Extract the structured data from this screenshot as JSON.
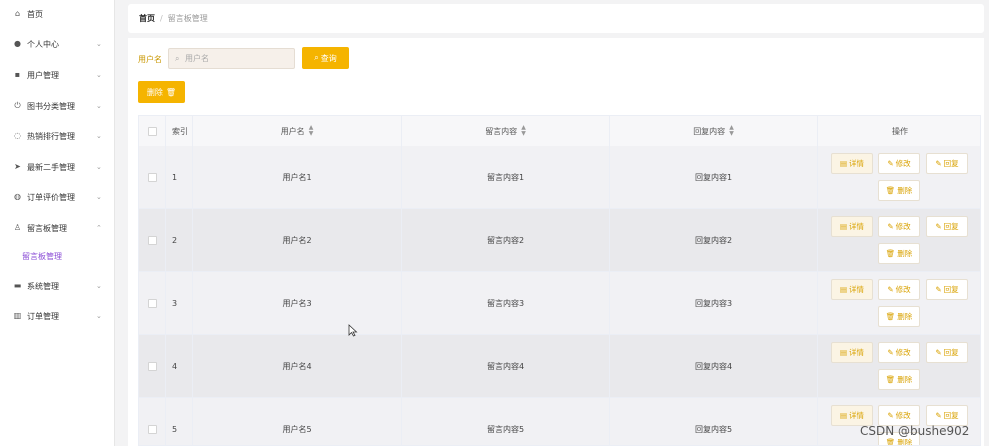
{
  "sidebar": {
    "items": [
      {
        "label": "首页",
        "icon": "home-icon",
        "glyph": "⌂",
        "expandable": false
      },
      {
        "label": "个人中心",
        "icon": "user-icon",
        "glyph": "●",
        "expandable": true
      },
      {
        "label": "用户管理",
        "icon": "users-icon",
        "glyph": "▪",
        "expandable": true
      },
      {
        "label": "图书分类管理",
        "icon": "power-icon",
        "glyph": "⏻",
        "expandable": true
      },
      {
        "label": "热销排行管理",
        "icon": "bulb-icon",
        "glyph": "◌",
        "expandable": true
      },
      {
        "label": "最新二手管理",
        "icon": "send-icon",
        "glyph": "➤",
        "expandable": true
      },
      {
        "label": "订单评价管理",
        "icon": "globe-icon",
        "glyph": "◍",
        "expandable": true
      },
      {
        "label": "留言板管理",
        "icon": "person-icon",
        "glyph": "♙",
        "expandable": true,
        "expanded": true
      },
      {
        "label": "系统管理",
        "icon": "server-icon",
        "glyph": "▬",
        "expandable": true
      },
      {
        "label": "订单管理",
        "icon": "chart-icon",
        "glyph": "▥",
        "expandable": true
      }
    ],
    "sub_item": "留言板管理",
    "chevron_down": "⌄",
    "chevron_up": "⌃"
  },
  "breadcrumb": {
    "home": "首页",
    "separator": "/",
    "current": "留言板管理"
  },
  "search": {
    "label": "用户名",
    "placeholder": "用户名",
    "value": "",
    "button": "查询"
  },
  "toolbar": {
    "delete_label": "删除"
  },
  "table": {
    "headers": {
      "index": "索引",
      "username": "用户名",
      "content": "留言内容",
      "reply": "回复内容",
      "actions": "操作"
    },
    "rows": [
      {
        "index": "1",
        "username": "用户名1",
        "content": "留言内容1",
        "reply": "回复内容1"
      },
      {
        "index": "2",
        "username": "用户名2",
        "content": "留言内容2",
        "reply": "回复内容2"
      },
      {
        "index": "3",
        "username": "用户名3",
        "content": "留言内容3",
        "reply": "回复内容3"
      },
      {
        "index": "4",
        "username": "用户名4",
        "content": "留言内容4",
        "reply": "回复内容4"
      },
      {
        "index": "5",
        "username": "用户名5",
        "content": "留言内容5",
        "reply": "回复内容5"
      }
    ],
    "actions": {
      "detail": "详情",
      "edit": "修改",
      "reply": "回复",
      "delete": "删除"
    }
  },
  "watermark": "CSDN @bushe902",
  "colors": {
    "accent": "#f5b400",
    "active_sub": "#8a4bd6",
    "action_text": "#d9a200"
  }
}
